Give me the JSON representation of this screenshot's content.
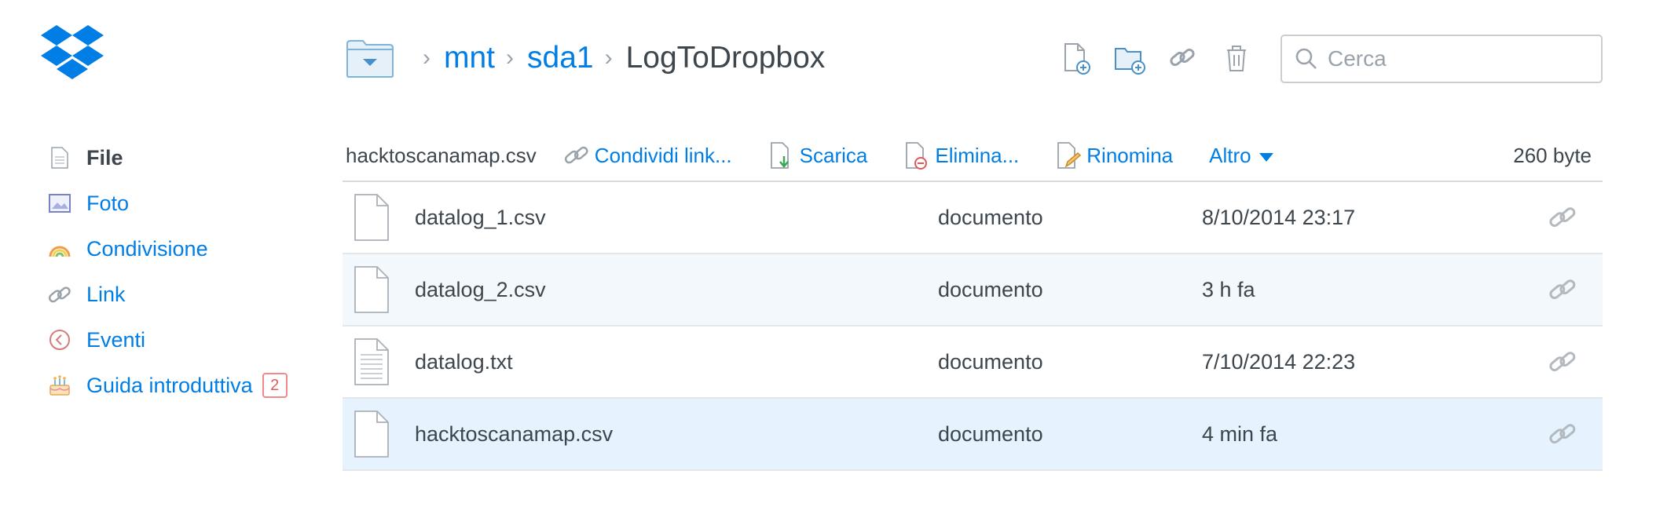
{
  "app": {
    "brand_color": "#007ee5",
    "text_color": "#3d464d"
  },
  "breadcrumb": {
    "folder_icon": "folder-dropdown-icon",
    "items": [
      "mnt",
      "sda1"
    ],
    "current": "LogToDropbox"
  },
  "top_actions": {
    "icons": [
      "new-file-icon",
      "new-folder-icon",
      "share-link-icon",
      "trash-icon"
    ]
  },
  "search": {
    "placeholder": "Cerca",
    "value": ""
  },
  "sidebar": {
    "items": [
      {
        "label": "File",
        "icon": "file-icon",
        "active": true
      },
      {
        "label": "Foto",
        "icon": "photo-icon"
      },
      {
        "label": "Condivisione",
        "icon": "rainbow-icon"
      },
      {
        "label": "Link",
        "icon": "link-icon"
      },
      {
        "label": "Eventi",
        "icon": "events-clock-icon"
      },
      {
        "label": "Guida introduttiva",
        "icon": "cake-icon",
        "badge": "2"
      }
    ]
  },
  "actionbar": {
    "selected_file": "hacktoscanamap.csv",
    "share": "Condividi link...",
    "download": "Scarica",
    "delete": "Elimina...",
    "rename": "Rinomina",
    "more": "Altro",
    "size": "260 byte"
  },
  "files": [
    {
      "name": "datalog_1.csv",
      "kind": "documento",
      "modified": "8/10/2014 23:17",
      "icon": "blank-file-icon"
    },
    {
      "name": "datalog_2.csv",
      "kind": "documento",
      "modified": "3 h fa",
      "icon": "blank-file-icon"
    },
    {
      "name": "datalog.txt",
      "kind": "documento",
      "modified": "7/10/2014 22:23",
      "icon": "text-file-icon"
    },
    {
      "name": "hacktoscanamap.csv",
      "kind": "documento",
      "modified": "4 min fa",
      "icon": "blank-file-icon",
      "selected": true
    }
  ]
}
